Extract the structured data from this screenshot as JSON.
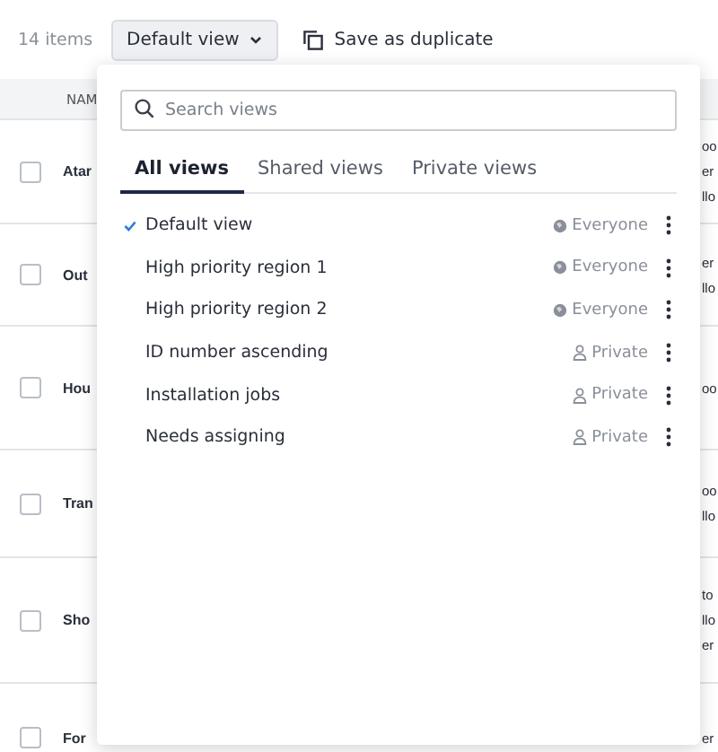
{
  "toolbar": {
    "count": "14 items",
    "view_button": "Default view",
    "duplicate_button": "Save as duplicate"
  },
  "table": {
    "columns": [
      "NAM"
    ],
    "rows": [
      {
        "name": "Atar",
        "checked": false,
        "column_2": [
          "oo",
          "er",
          "llo"
        ]
      },
      {
        "name": "Out",
        "checked": false,
        "column_2": [
          "er",
          "llo"
        ]
      },
      {
        "name": "Hou",
        "checked": false,
        "column_2": [
          "oo"
        ]
      },
      {
        "name": "Tran",
        "checked": false,
        "column_2": [
          "oo",
          "llo"
        ]
      },
      {
        "name": "Sho",
        "checked": false,
        "column_2": [
          "to",
          "llo",
          "er"
        ]
      },
      {
        "name": "For",
        "checked": false,
        "column_2": [
          "er"
        ]
      }
    ]
  },
  "views_menu": {
    "search": {
      "placeholder": "Search views"
    },
    "tabs": [
      {
        "label": "All views",
        "selected": true
      },
      {
        "label": "Shared views",
        "selected": false
      },
      {
        "label": "Private views",
        "selected": false
      }
    ],
    "items": [
      {
        "label": "Default view",
        "selected": true,
        "kind": "everyone",
        "visibility": "Everyone"
      },
      {
        "label": "High priority region 1",
        "selected": false,
        "kind": "everyone",
        "visibility": "Everyone"
      },
      {
        "label": "High priority region 2",
        "selected": false,
        "kind": "everyone",
        "visibility": "Everyone"
      },
      {
        "label": "ID number ascending",
        "selected": false,
        "kind": "private",
        "visibility": "Private"
      },
      {
        "label": "Installation jobs",
        "selected": false,
        "kind": "private",
        "visibility": "Private"
      },
      {
        "label": "Needs assigning",
        "selected": false,
        "kind": "private",
        "visibility": "Private"
      }
    ]
  }
}
